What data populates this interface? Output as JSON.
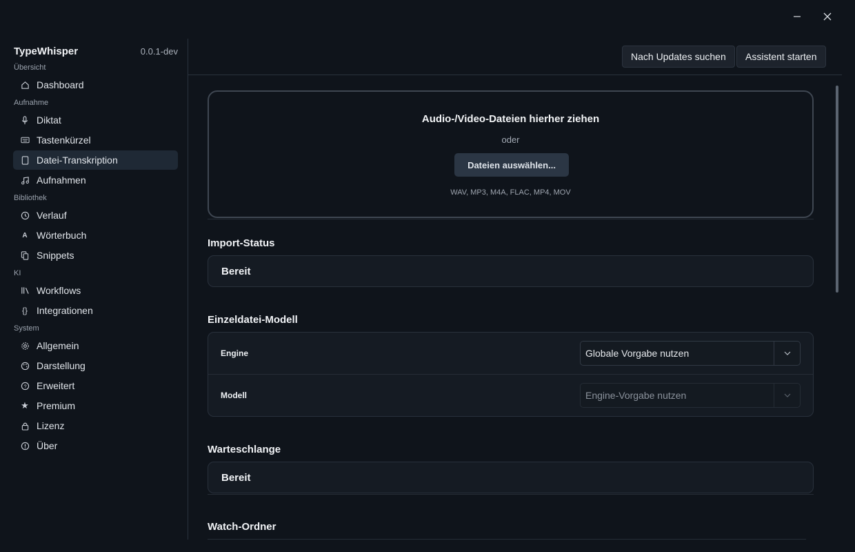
{
  "window": {
    "minimize_icon": "minimize-icon",
    "close_icon": "close-icon"
  },
  "sidebar": {
    "app_name": "TypeWhisper",
    "version": "0.0.1-dev",
    "sections": {
      "overview": "Übersicht",
      "recording": "Aufnahme",
      "library": "Bibliothek",
      "ai": "KI",
      "system": "System"
    },
    "items": [
      {
        "label": "Dashboard",
        "icon": "home-icon"
      },
      {
        "label": "Diktat",
        "icon": "microphone-icon"
      },
      {
        "label": "Tastenkürzel",
        "icon": "keyboard-icon"
      },
      {
        "label": "Datei-Transkription",
        "icon": "file-icon",
        "active": true
      },
      {
        "label": "Aufnahmen",
        "icon": "music-note-icon"
      },
      {
        "label": "Verlauf",
        "icon": "history-icon"
      },
      {
        "label": "Wörterbuch",
        "icon": "dictionary-icon"
      },
      {
        "label": "Snippets",
        "icon": "copy-icon"
      },
      {
        "label": "Workflows",
        "icon": "library-icon"
      },
      {
        "label": "Integrationen",
        "icon": "braces-icon"
      },
      {
        "label": "Allgemein",
        "icon": "gear-icon"
      },
      {
        "label": "Darstellung",
        "icon": "palette-icon"
      },
      {
        "label": "Erweitert",
        "icon": "help-circle-icon"
      },
      {
        "label": "Premium",
        "icon": "star-icon"
      },
      {
        "label": "Lizenz",
        "icon": "lock-icon"
      },
      {
        "label": "Über",
        "icon": "info-icon"
      }
    ]
  },
  "toolbar": {
    "check_updates_label": "Nach Updates suchen",
    "start_assistant_label": "Assistent starten"
  },
  "dropzone": {
    "title": "Audio-/Video-Dateien hierher ziehen",
    "or_text": "oder",
    "select_button": "Dateien auswählen...",
    "formats": "WAV, MP3, M4A, FLAC, MP4, MOV"
  },
  "import_status": {
    "title": "Import-Status",
    "value": "Bereit"
  },
  "single_file_model": {
    "title": "Einzeldatei-Modell",
    "engine_label": "Engine",
    "engine_value": "Globale Vorgabe nutzen",
    "model_label": "Modell",
    "model_value": "Engine-Vorgabe nutzen"
  },
  "queue": {
    "title": "Warteschlange",
    "value": "Bereit"
  },
  "watch_folder": {
    "title": "Watch-Ordner"
  }
}
